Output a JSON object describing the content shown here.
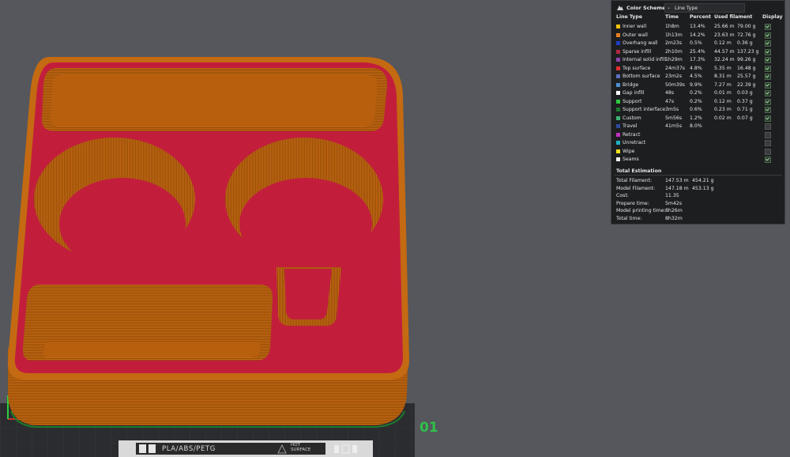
{
  "plate": {
    "index_label": "01",
    "filament_types": "PLA/ABS/PETG",
    "surface_label": "HOT SURFACE"
  },
  "panel": {
    "title": "Color Scheme",
    "scheme_value": "Line Type",
    "columns": [
      "Line Type",
      "Time",
      "Percent",
      "Used filament",
      "Display"
    ],
    "rows": [
      {
        "name": "Inner wall",
        "time": "1h8m",
        "percent": "13.4%",
        "length": "25.66 m",
        "weight": "79.00 g",
        "color": "#f1c40f",
        "display": true
      },
      {
        "name": "Outer wall",
        "time": "1h13m",
        "percent": "14.2%",
        "length": "23.63 m",
        "weight": "72.76 g",
        "color": "#e67e22",
        "display": true
      },
      {
        "name": "Overhang wall",
        "time": "2m23s",
        "percent": "0.5%",
        "length": "0.12 m",
        "weight": "0.36 g",
        "color": "#1f3fc4",
        "display": true
      },
      {
        "name": "Sparse infill",
        "time": "2h10m",
        "percent": "25.4%",
        "length": "44.57 m",
        "weight": "137.23 g",
        "color": "#b0283f",
        "display": true
      },
      {
        "name": "Internal solid infill",
        "time": "1h29m",
        "percent": "17.3%",
        "length": "32.24 m",
        "weight": "99.26 g",
        "color": "#8e44ad",
        "display": true
      },
      {
        "name": "Top surface",
        "time": "24m37s",
        "percent": "4.8%",
        "length": "5.35 m",
        "weight": "16.48 g",
        "color": "#e03030",
        "display": true
      },
      {
        "name": "Bottom surface",
        "time": "23m2s",
        "percent": "4.5%",
        "length": "8.31 m",
        "weight": "25.57 g",
        "color": "#5a6fc0",
        "display": true
      },
      {
        "name": "Bridge",
        "time": "50m39s",
        "percent": "9.9%",
        "length": "7.27 m",
        "weight": "22.39 g",
        "color": "#4a8fd0",
        "display": true
      },
      {
        "name": "Gap infill",
        "time": "48s",
        "percent": "0.2%",
        "length": "0.01 m",
        "weight": "0.03 g",
        "color": "#ffffff",
        "display": true
      },
      {
        "name": "Support",
        "time": "47s",
        "percent": "0.2%",
        "length": "0.12 m",
        "weight": "0.37 g",
        "color": "#2ecc40",
        "display": true
      },
      {
        "name": "Support interface",
        "time": "3m5s",
        "percent": "0.6%",
        "length": "0.23 m",
        "weight": "0.71 g",
        "color": "#1e7a2e",
        "display": true
      },
      {
        "name": "Custom",
        "time": "5m56s",
        "percent": "1.2%",
        "length": "0.02 m",
        "weight": "0.07 g",
        "color": "#3cb371",
        "display": true
      },
      {
        "name": "Travel",
        "time": "41m5s",
        "percent": "8.0%",
        "length": "",
        "weight": "",
        "color": "#2e4a9e",
        "display": false
      },
      {
        "name": "Retract",
        "time": "",
        "percent": "",
        "length": "",
        "weight": "",
        "color": "#c030c0",
        "display": false
      },
      {
        "name": "Unretract",
        "time": "",
        "percent": "",
        "length": "",
        "weight": "",
        "color": "#20b0c0",
        "display": false
      },
      {
        "name": "Wipe",
        "time": "",
        "percent": "",
        "length": "",
        "weight": "",
        "color": "#f5e020",
        "display": false
      },
      {
        "name": "Seams",
        "time": "",
        "percent": "",
        "length": "",
        "weight": "",
        "color": "#eeeeee",
        "display": true
      }
    ],
    "estimation": {
      "title": "Total Estimation",
      "total_filament_label": "Total Filament:",
      "total_filament_len": "147.53 m",
      "total_filament_wt": "454.21 g",
      "model_filament_label": "Model Filament:",
      "model_filament_len": "147.18 m",
      "model_filament_wt": "453.13 g",
      "cost_label": "Cost:",
      "cost": "11.35",
      "prepare_label": "Prepare time:",
      "prepare": "5m42s",
      "model_time_label": "Model printing time:",
      "model_time": "8h26m",
      "total_time_label": "Total time:",
      "total_time": "8h32m"
    }
  }
}
